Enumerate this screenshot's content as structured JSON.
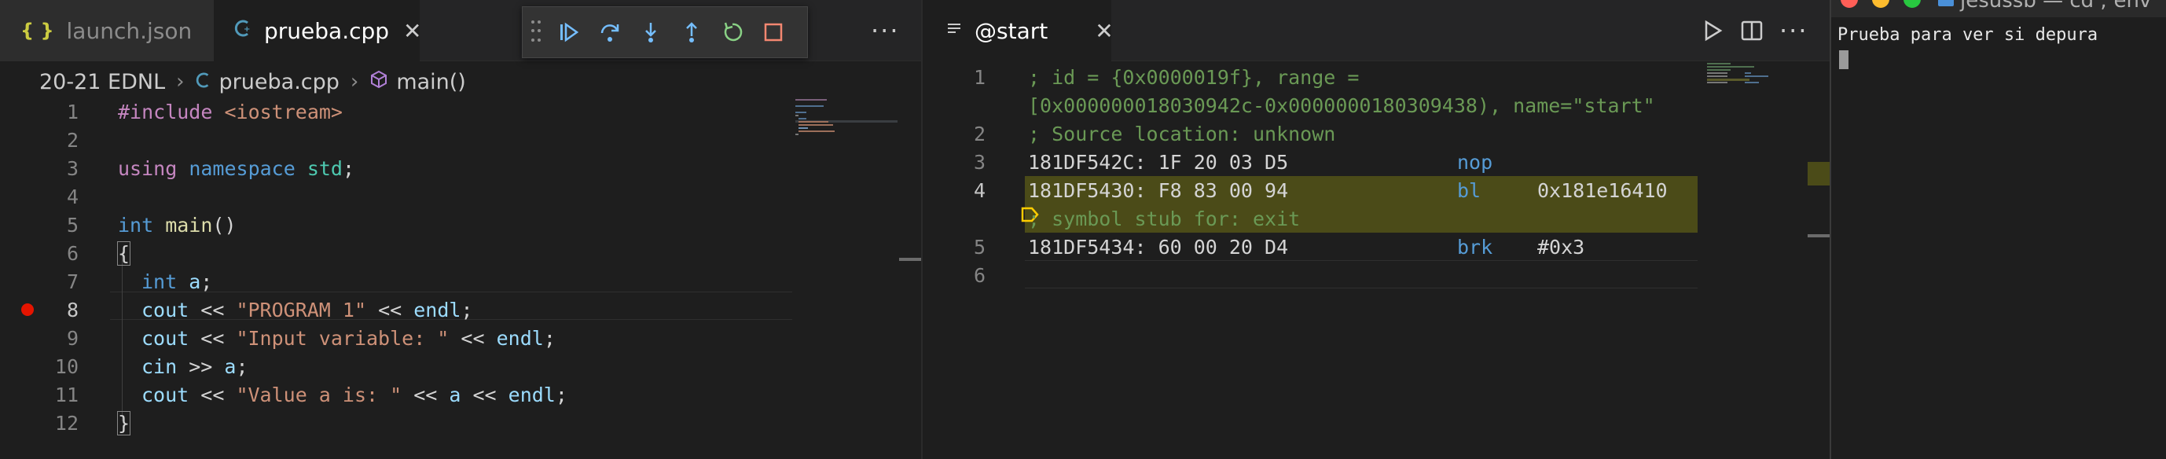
{
  "left_editor": {
    "tabs": [
      {
        "label": "launch.json",
        "icon": "{ }",
        "active": false
      },
      {
        "label": "prueba.cpp",
        "icon": "C",
        "active": true
      }
    ],
    "more_label": "···",
    "breadcrumb": [
      "20-21 EDNL",
      "prueba.cpp",
      "main()"
    ],
    "lines": [
      {
        "n": "1"
      },
      {
        "n": "2"
      },
      {
        "n": "3"
      },
      {
        "n": "4"
      },
      {
        "n": "5"
      },
      {
        "n": "6"
      },
      {
        "n": "7"
      },
      {
        "n": "8"
      },
      {
        "n": "9"
      },
      {
        "n": "10"
      },
      {
        "n": "11"
      },
      {
        "n": "12"
      }
    ],
    "code": {
      "l1_a": "#include",
      "l1_b": " <iostream>",
      "l3_a": "using",
      "l3_b": " namespace",
      "l3_c": " std",
      "l3_d": ";",
      "l5_a": "int",
      "l5_b": " main",
      "l5_c": "()",
      "l6": "{",
      "l7_a": "int",
      "l7_b": " a",
      "l7_c": ";",
      "l8_a": "cout",
      "l8_b": " << ",
      "l8_c": "\"PROGRAM 1\"",
      "l8_d": " << ",
      "l8_e": "endl",
      "l8_f": ";",
      "l9_a": "cout",
      "l9_b": " << ",
      "l9_c": "\"Input variable: \"",
      "l9_d": " << ",
      "l9_e": "endl",
      "l9_f": ";",
      "l10_a": "cin",
      "l10_b": " >> ",
      "l10_c": "a",
      "l10_d": ";",
      "l11_a": "cout",
      "l11_b": " << ",
      "l11_c": "\"Value a is: \"",
      "l11_d": " << ",
      "l11_e": "a",
      "l11_f": " << ",
      "l11_g": "endl",
      "l11_h": ";",
      "l12": "}"
    },
    "breakpoint_line": "8"
  },
  "right_editor": {
    "tab": {
      "label": "@start",
      "icon": "disassembly-icon"
    },
    "more_label": "···",
    "lines": [
      {
        "n": "1",
        "text_a": "; id = {0x0000019f}, range =",
        "text_b": "[0x000000018030942c-0x0000000180309438), name=\"start\""
      },
      {
        "n": "2",
        "text": "; Source location: unknown"
      },
      {
        "n": "3",
        "addr": "181DF542C: 1F 20 03 D5",
        "op": "nop",
        "arg": ""
      },
      {
        "n": "4",
        "addr": "181DF5430: F8 83 00 94",
        "op": "bl",
        "arg": "0x181e16410",
        "comment": "; symbol stub for: exit"
      },
      {
        "n": "5",
        "addr": "181DF5434: 60 00 20 D4",
        "op": "brk",
        "arg": "#0x3"
      },
      {
        "n": "6"
      }
    ],
    "current_line": "4",
    "highlight_color": "#4b4b18"
  },
  "terminal": {
    "title": "jesussb — cd  ; env",
    "output": "Prueba para ver si depura"
  }
}
